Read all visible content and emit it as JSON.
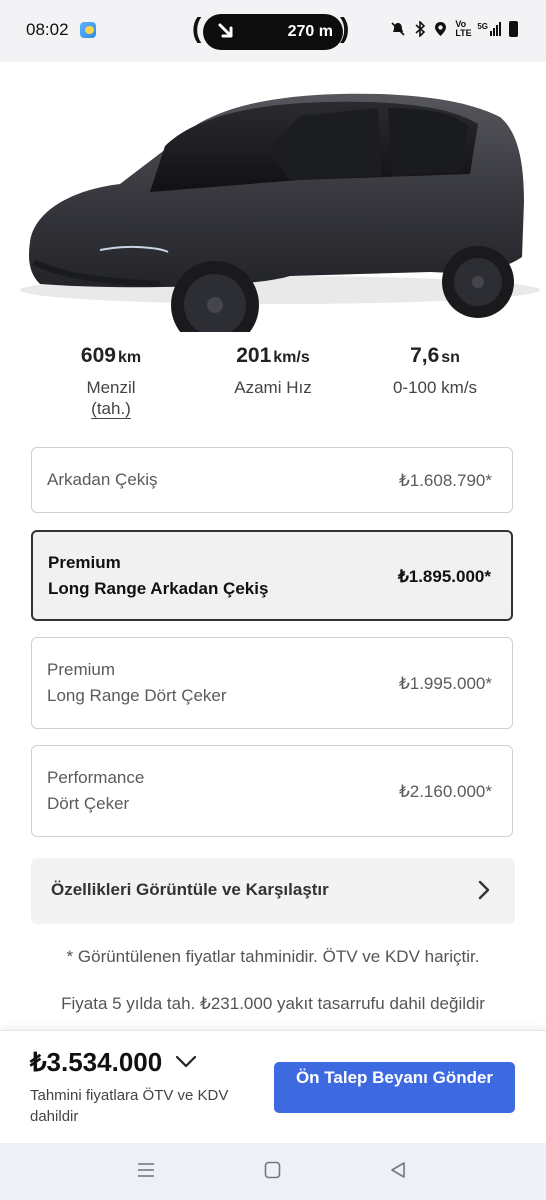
{
  "status_bar": {
    "time": "08:02",
    "nav_distance": "270 m",
    "icons": [
      "weather-icon",
      "turn-right-icon",
      "mute-icon",
      "bluetooth-icon",
      "location-icon",
      "volte-icon",
      "signal-5g-icon",
      "battery-icon"
    ],
    "volte_label": "Vo LTE",
    "network_label": "5G"
  },
  "specs": [
    {
      "value": "609",
      "unit": "km",
      "label": "Menzil",
      "sublabel": "(tah.)"
    },
    {
      "value": "201",
      "unit": "km/s",
      "label": "Azami Hız"
    },
    {
      "value": "7,6",
      "unit": "sn",
      "label": "0-100 km/s"
    }
  ],
  "trims": [
    {
      "line1": "Arkadan Çekiş",
      "line2": "",
      "price": "₺1.608.790*",
      "selected": false
    },
    {
      "line1": "Premium",
      "line2": "Long Range Arkadan Çekiş",
      "price": "₺1.895.000*",
      "selected": true
    },
    {
      "line1": "Premium",
      "line2": "Long Range Dört Çeker",
      "price": "₺1.995.000*",
      "selected": false
    },
    {
      "line1": "Performance",
      "line2": "Dört Çeker",
      "price": "₺2.160.000*",
      "selected": false
    }
  ],
  "compare_label": "Özellikleri Görüntüle ve Karşılaştır",
  "notes": {
    "estimate": "* Görüntülenen fiyatlar tahminidir. ÖTV ve KDV hariçtir.",
    "savings": "Fiyata 5 yılda tah. ₺231.000 yakıt tasarrufu dahil değildir"
  },
  "bottom": {
    "total": "₺3.534.000",
    "total_note": "Tahmini fiyatlara ÖTV ve KDV dahildir",
    "cta": "Ön Talep Beyanı Gönder"
  },
  "colors": {
    "accent": "#3e6ae1",
    "car": "#3a3b40"
  }
}
